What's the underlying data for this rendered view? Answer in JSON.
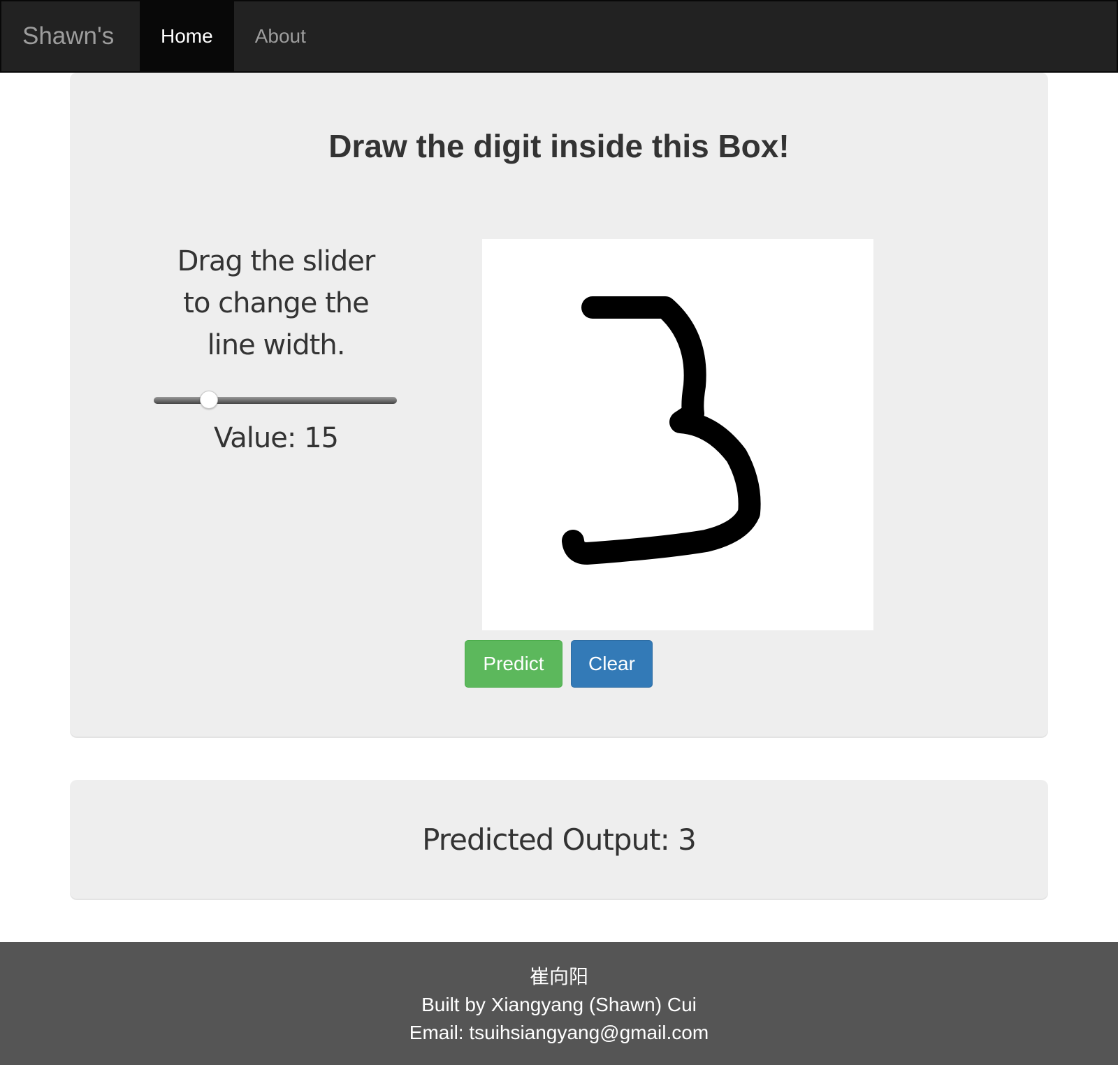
{
  "nav": {
    "brand": "Shawn's",
    "items": [
      {
        "label": "Home",
        "active": true
      },
      {
        "label": "About",
        "active": false
      }
    ]
  },
  "main": {
    "title": "Draw the digit inside this Box!",
    "instruction": "Drag the slider to change the line width.",
    "slider": {
      "min": 1,
      "max": 100,
      "value": 15
    },
    "value_label": "Value: 15",
    "buttons": {
      "predict": "Predict",
      "clear": "Clear"
    },
    "canvas": {
      "drawn_digit": "3",
      "stroke_color": "#000000",
      "background": "#ffffff"
    }
  },
  "result": {
    "text": "Predicted Output: 3"
  },
  "footer": {
    "name_zh": "崔向阳",
    "built_by": "Built by Xiangyang (Shawn) Cui",
    "email": "Email: tsuihsiangyang@gmail.com"
  },
  "colors": {
    "navbar": "#222222",
    "predict": "#5cb85c",
    "clear": "#337ab7",
    "jumbotron": "#eeeeee",
    "footer": "#555555"
  }
}
